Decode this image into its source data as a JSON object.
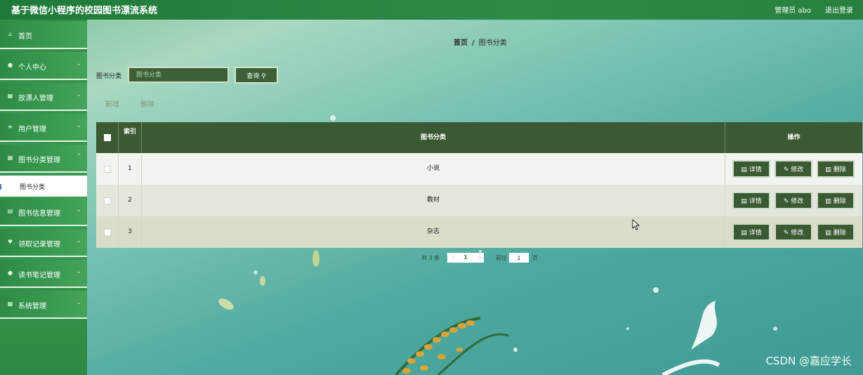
{
  "header": {
    "title": "基于微信小程序的校园图书漂流系统",
    "user": "管理员 abo",
    "logout": "退出登录"
  },
  "sidebar": {
    "items": [
      {
        "label": "首页",
        "icon": "home-icon"
      },
      {
        "label": "个人中心",
        "icon": "user-icon"
      },
      {
        "label": "放漂人管理",
        "icon": "grid-icon"
      },
      {
        "label": "用户管理",
        "icon": "list-icon"
      },
      {
        "label": "图书分类管理",
        "icon": "grid-icon"
      },
      {
        "label": "图书信息管理",
        "icon": "book-icon"
      },
      {
        "label": "领取记录管理",
        "icon": "badge-icon"
      },
      {
        "label": "读书笔记管理",
        "icon": "pin-icon"
      },
      {
        "label": "系统管理",
        "icon": "grid-icon"
      }
    ],
    "active_sub": "图书分类"
  },
  "breadcrumb": {
    "home": "首页",
    "separator": "/",
    "current": "图书分类"
  },
  "search": {
    "label": "图书分类",
    "placeholder": "图书分类",
    "button": "查询"
  },
  "actions": {
    "add": "新增",
    "delete": "删除"
  },
  "table": {
    "headers": {
      "index": "索引",
      "name": "图书分类",
      "ops": "操作"
    },
    "rows": [
      {
        "index": "1",
        "name": "小说"
      },
      {
        "index": "2",
        "name": "教材"
      },
      {
        "index": "3",
        "name": "杂志"
      }
    ],
    "row_buttons": {
      "detail": "详情",
      "edit": "修改",
      "delete": "删除"
    }
  },
  "pagination": {
    "total": "共 3 条",
    "current_page": "1",
    "goto_label": "前往",
    "goto_value": "1",
    "page_suffix": "页"
  },
  "watermark": "CSDN @嘉应学长",
  "colors": {
    "header_green": "#2e8b47",
    "dark_green": "#3b5a33",
    "sidebar_green": "#3a9a50"
  }
}
